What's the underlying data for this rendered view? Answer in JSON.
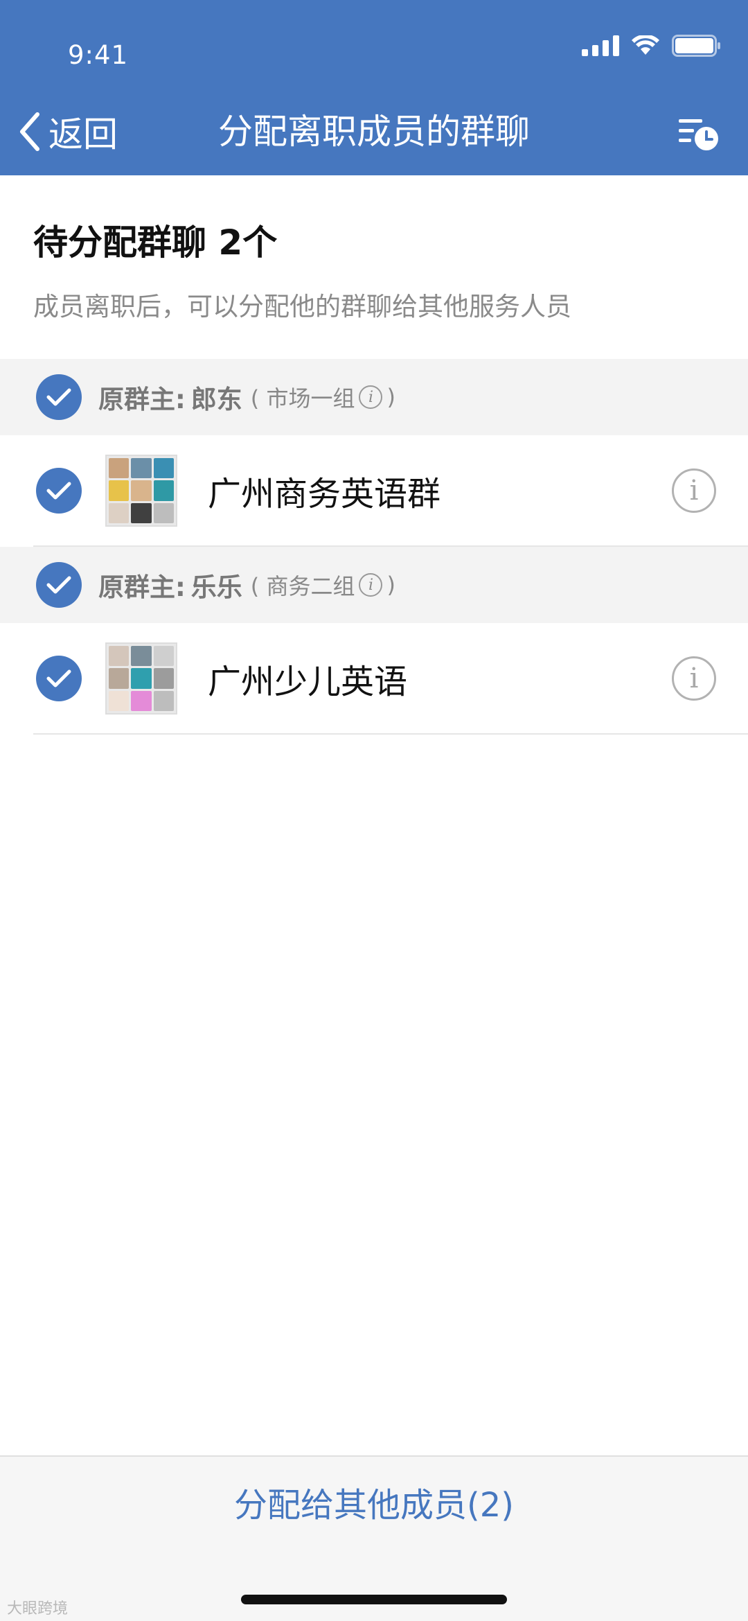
{
  "status_bar": {
    "time": "9:41"
  },
  "nav": {
    "back_label": "返回",
    "title": "分配离职成员的群聊",
    "history_icon": "history-list-icon"
  },
  "summary": {
    "title": "待分配群聊 2个",
    "description": "成员离职后，可以分配他的群聊给其他服务人员"
  },
  "groups": [
    {
      "owner_label": "原群主:",
      "owner_name": "郎东",
      "owner_team": "( 市场一组",
      "owner_team_close": ")",
      "group_name": "广州商务英语群"
    },
    {
      "owner_label": "原群主:",
      "owner_name": "乐乐",
      "owner_team": "( 商务二组",
      "owner_team_close": ")",
      "group_name": "广州少儿英语"
    }
  ],
  "bottom": {
    "assign_label": "分配给其他成员(2)"
  },
  "watermark": "大眼跨境",
  "colors": {
    "accent": "#4677bf",
    "muted": "#8a8a8a"
  }
}
